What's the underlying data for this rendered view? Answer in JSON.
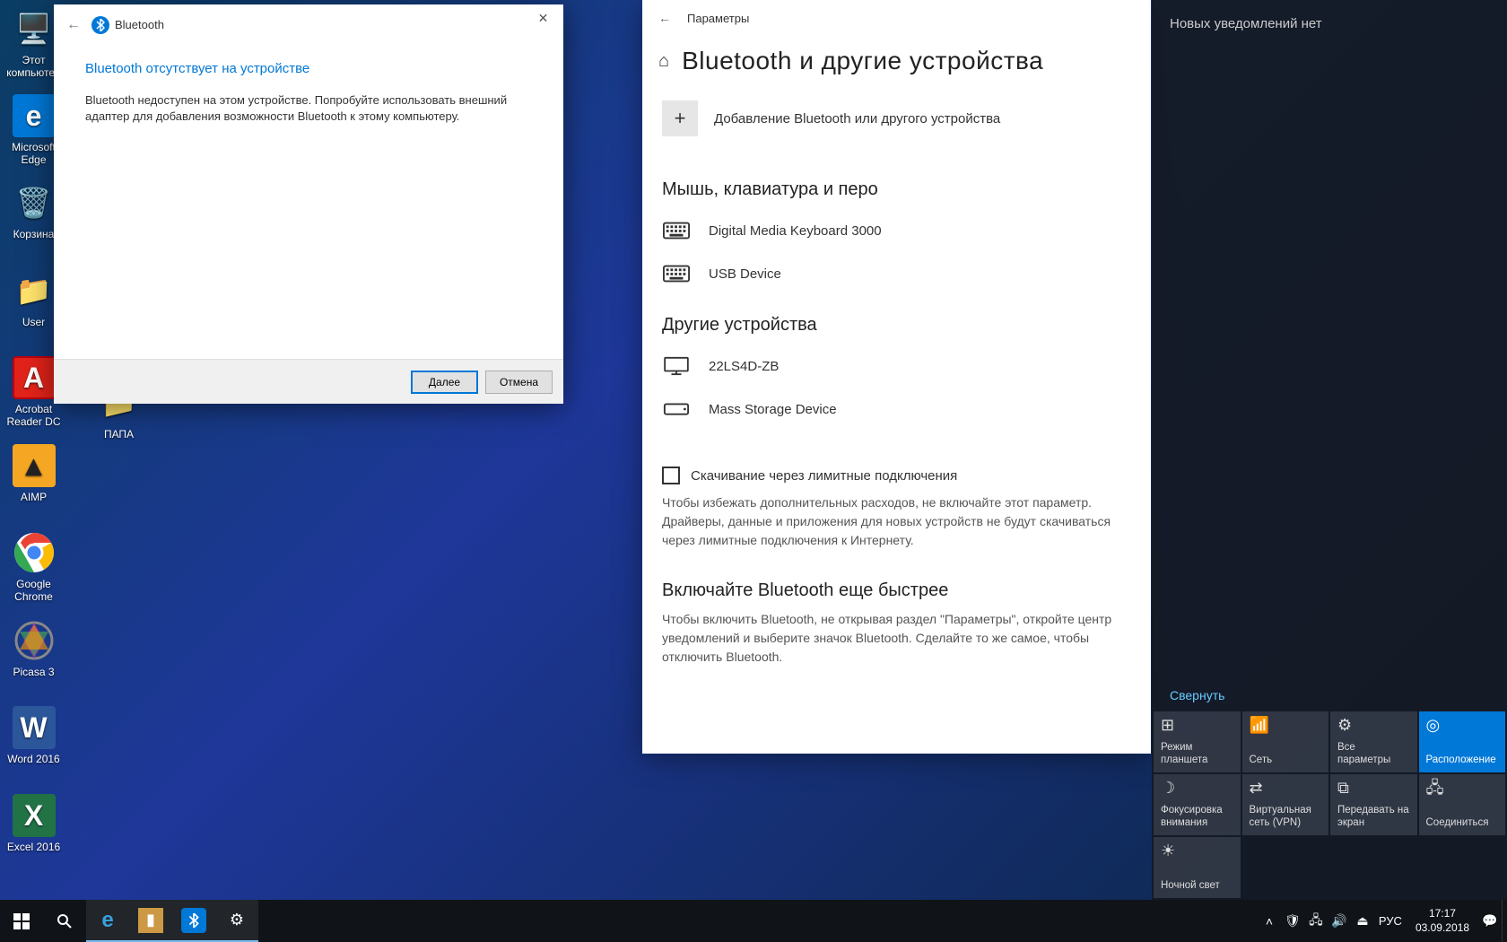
{
  "desktop": {
    "icons": [
      {
        "label": "Этот компьютер",
        "glyph": "🖥️"
      },
      {
        "label": "Microsoft Edge",
        "glyph": "e",
        "bg": "#0078d7"
      },
      {
        "label": "Корзина",
        "glyph": "🗑️"
      },
      {
        "label": "User",
        "glyph": "📁"
      },
      {
        "label": "Acrobat Reader DC",
        "glyph": "A",
        "bg": "#e2231a"
      },
      {
        "label": "AIMP",
        "glyph": "▲",
        "bg": "#f5a623"
      },
      {
        "label": "Google Chrome",
        "glyph": "◉"
      },
      {
        "label": "Picasa 3",
        "glyph": "◐"
      },
      {
        "label": "Word 2016",
        "glyph": "W",
        "bg": "#2b579a"
      },
      {
        "label": "Excel 2016",
        "glyph": "X",
        "bg": "#217346"
      }
    ],
    "icons_col2": [
      {
        "label": "ПАПА",
        "glyph": "📁"
      }
    ]
  },
  "wizard": {
    "title": "Bluetooth",
    "heading": "Bluetooth отсутствует на устройстве",
    "body": "Bluetooth недоступен на этом устройстве. Попробуйте использовать внешний адаптер для добавления возможности Bluetooth к этому компьютеру.",
    "next": "Далее",
    "cancel": "Отмена"
  },
  "settings": {
    "app": "Параметры",
    "title": "Bluetooth и другие устройства",
    "add": "Добавление Bluetooth или другого устройства",
    "sec1": "Мышь, клавиатура и перо",
    "dev1": "Digital Media Keyboard 3000",
    "dev2": "USB Device",
    "sec2": "Другие устройства",
    "dev3": "22LS4D-ZB",
    "dev4": "Mass Storage Device",
    "metered": "Скачивание через лимитные подключения",
    "metered_hint": "Чтобы избежать дополнительных расходов, не включайте этот параметр. Драйверы, данные и приложения для новых устройств не будут скачиваться через лимитные подключения к Интернету.",
    "faster_h": "Включайте Bluetooth еще быстрее",
    "faster_p": "Чтобы включить Bluetooth, не открывая раздел \"Параметры\", откройте центр уведомлений и выберите значок Bluetooth. Сделайте то же самое, чтобы отключить Bluetooth."
  },
  "action_center": {
    "heading": "Новых уведомлений нет",
    "collapse": "Свернуть",
    "tiles": [
      {
        "label": "Режим планшета",
        "icon": "⊞"
      },
      {
        "label": "Сеть",
        "icon": "📶"
      },
      {
        "label": "Все параметры",
        "icon": "⚙"
      },
      {
        "label": "Расположение",
        "icon": "📍",
        "on": true
      },
      {
        "label": "Фокусировка внимания",
        "icon": "☽"
      },
      {
        "label": "Виртуальная сеть (VPN)",
        "icon": "⇄"
      },
      {
        "label": "Передавать на экран",
        "icon": "⧉"
      },
      {
        "label": "Соединиться",
        "icon": "🖧"
      },
      {
        "label": "Ночной свет",
        "icon": "☀"
      }
    ]
  },
  "taskbar": {
    "lang": "РУС",
    "time": "17:17",
    "date": "03.09.2018"
  }
}
